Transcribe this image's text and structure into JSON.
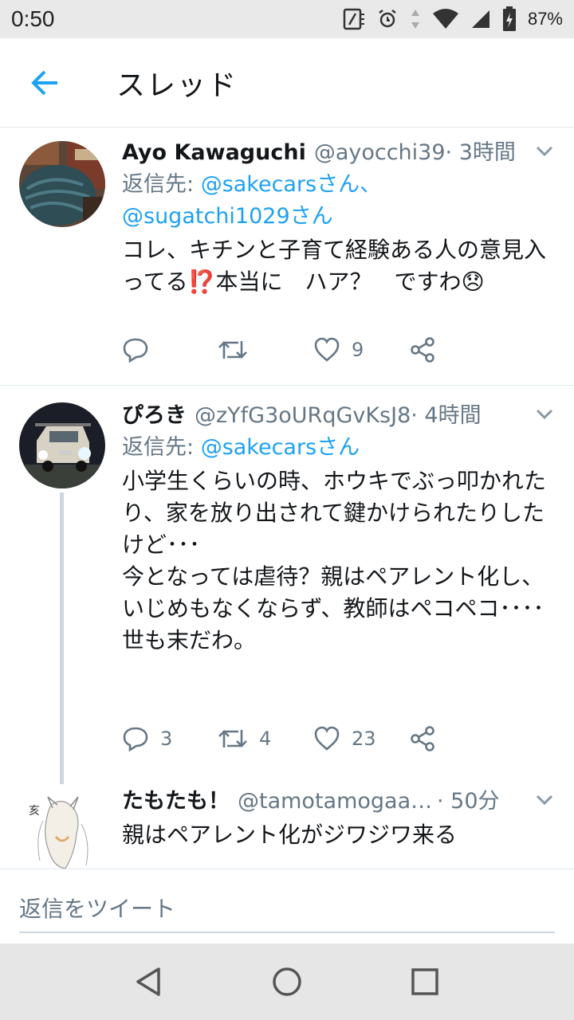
{
  "status_bar": {
    "time": "0:50",
    "battery": "87%"
  },
  "app_bar": {
    "title": "スレッド"
  },
  "tweets": [
    {
      "name": "Ayo Kawaguchi",
      "handle": "@ayocchi39",
      "time": " · 3時間",
      "reply_prefix": "返信先: ",
      "reply_mentions": "@sakecarsさん、@sugatchi1029さん",
      "text": "コレ、キチンと子育て経験ある人の意見入ってる⁉️本当に　ハア？　ですわ😞",
      "replies": "",
      "retweets": "",
      "likes": "9"
    },
    {
      "name": "ぴろき",
      "handle": "@zYfG3oURqGvKsJ8",
      "time": " · 4時間",
      "reply_prefix": "返信先: ",
      "reply_mentions": "@sakecarsさん",
      "text": "小学生くらいの時、ホウキでぶっ叩かれたり、家を放り出されて鍵かけられたりしたけど･･･\n今となっては虐待？親はペアレント化し、いじめもなくならず、教師はペコペコ････\n世も末だわ。",
      "replies": "3",
      "retweets": "4",
      "likes": "23"
    },
    {
      "name": "たもたも！",
      "handle": "@tamotamogaaa...",
      "time": " · 50分",
      "text": "親はペアレント化がジワジワ来る"
    }
  ],
  "composer": {
    "placeholder": "返信をツイート"
  },
  "colors": {
    "accent": "#1da1f2",
    "secondary_text": "#657786",
    "primary_text": "#14171a"
  }
}
